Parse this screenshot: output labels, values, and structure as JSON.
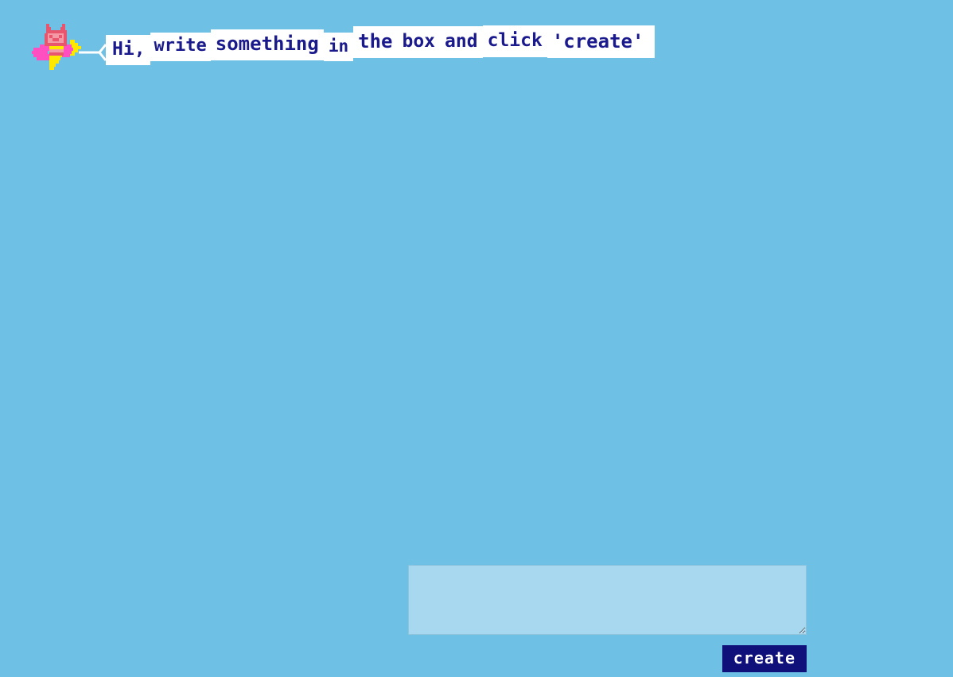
{
  "page": {
    "background_color": "#6ec1e4"
  },
  "character": {
    "name": "flying-cat-mascot",
    "colors": {
      "outline": "#e8566e",
      "face": "#f49aa6",
      "feature": "#e8566e",
      "wing": "#ff4fc0",
      "flame": "#ffe800",
      "body_stripe": "#ffe800"
    }
  },
  "speech_bubble": {
    "full_text": "Hi, write something in the box and click 'create'",
    "text_color": "#1a1a8c",
    "background_color": "#ffffff",
    "segments": [
      "Hi,",
      "write",
      "something",
      "in",
      "the",
      "box",
      "and",
      "click",
      "'create'"
    ]
  },
  "composer": {
    "input": {
      "value": "",
      "placeholder": "",
      "background_color": "#a8d8f0"
    },
    "create_label": "create",
    "create_button_color": "#10107a"
  }
}
